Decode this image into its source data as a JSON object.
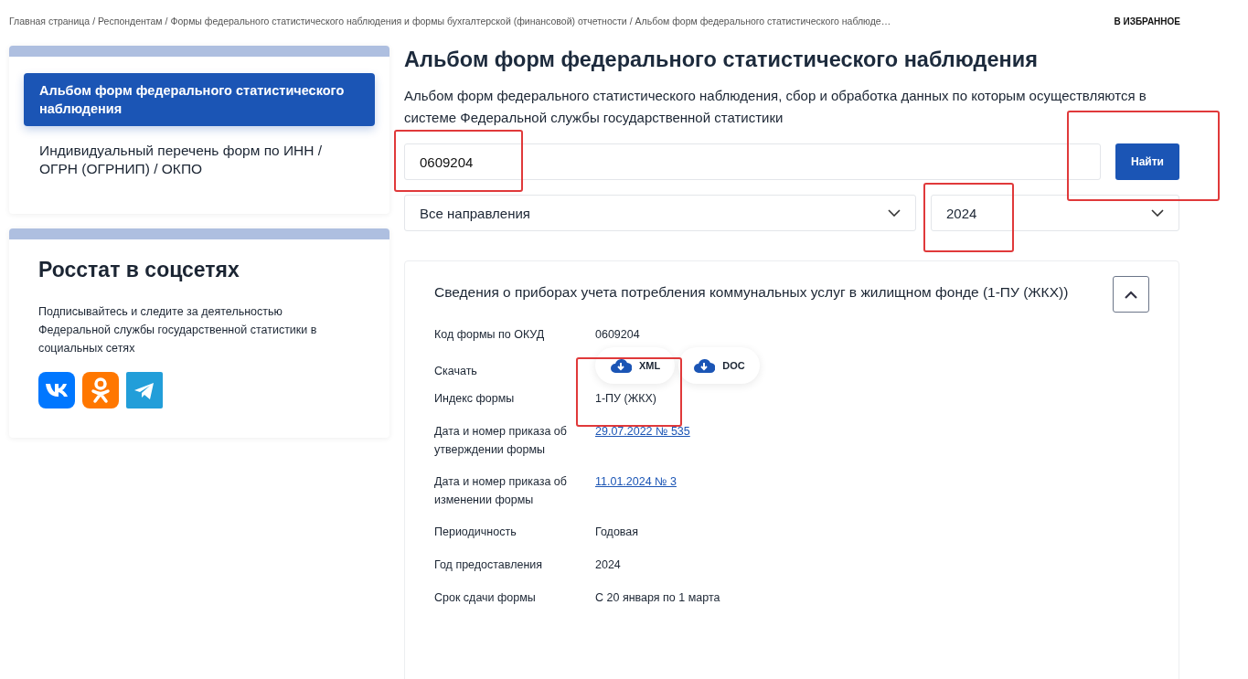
{
  "breadcrumbs": [
    "Главная страница",
    "Респондентам",
    "Формы федерального статистического наблюдения и формы бухгалтерской (финансовой) отчетности",
    "Альбом форм федерального статистического наблюде…"
  ],
  "breadcrumb_separator": "/",
  "favorite_link": "В ИЗБРАННОЕ",
  "sidebar": {
    "items": [
      {
        "label": "Альбом форм федерального статистического наблюдения",
        "selected": true
      },
      {
        "label": "Индивидуальный перечень форм по ИНН / ОГРН (ОГРНИП) / ОКПО",
        "selected": false
      }
    ]
  },
  "social": {
    "title": "Росстат в соцсетях",
    "text": "Подписывайтесь и следите за деятельностью Федеральной службы государственной статистики в социальных сетях"
  },
  "page": {
    "title": "Альбом форм федерального статистического наблюдения",
    "description": "Альбом форм федерального статистического наблюдения, сбор и обработка данных по которым осуществляются в системе Федеральной службы государственной статистики"
  },
  "search": {
    "value": "0609204",
    "button": "Найти"
  },
  "filters": [
    {
      "value": "Все направления"
    },
    {
      "value": "2024"
    }
  ],
  "form_card": {
    "title": "Сведения о приборах учета потребления коммунальных услуг в жилищном фонде (1-ПУ (ЖКХ))",
    "expanded": true,
    "rows": [
      {
        "kind": "text",
        "label": "Код формы по ОКУД",
        "value": "0609204"
      },
      {
        "kind": "downloads",
        "label": "Скачать",
        "buttons": [
          "XML",
          "DOC"
        ]
      },
      {
        "kind": "text",
        "label": "Индекс формы",
        "value": "1-ПУ (ЖКХ)"
      },
      {
        "kind": "link",
        "label": "Дата и номер приказа об утверждении формы",
        "value": "29.07.2022 № 535"
      },
      {
        "kind": "link",
        "label": "Дата и номер приказа об изменении формы",
        "value": "11.01.2024 № 3"
      },
      {
        "kind": "text",
        "label": "Периодичность",
        "value": "Годовая"
      },
      {
        "kind": "text",
        "label": "Год предоставления",
        "value": "2024"
      },
      {
        "kind": "text",
        "label": "Срок сдачи формы",
        "value": "С 20 января по 1 марта"
      }
    ]
  }
}
